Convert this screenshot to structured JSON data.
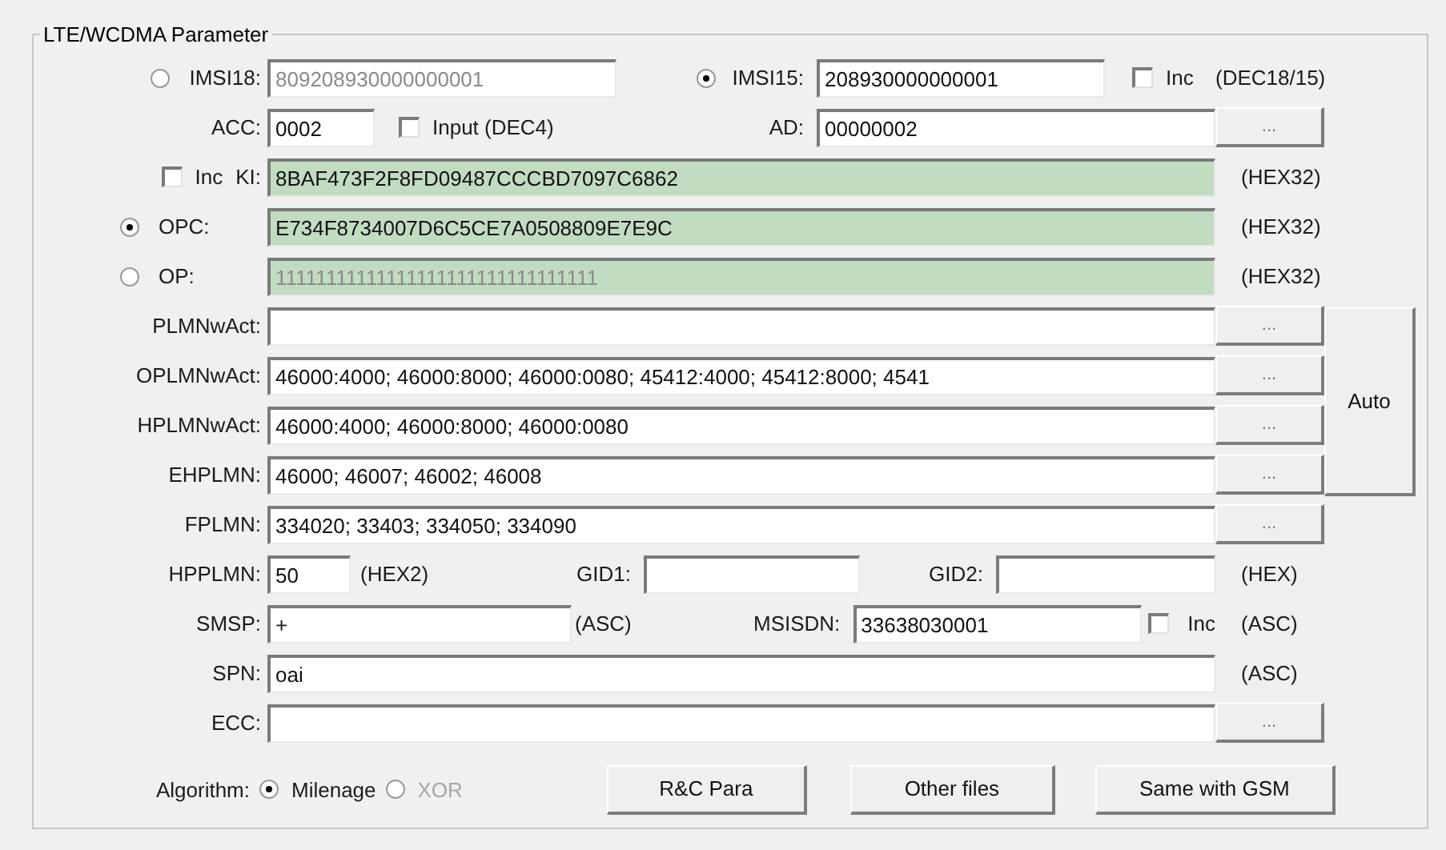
{
  "group_title": "LTE/WCDMA Parameter",
  "imsi18": {
    "label": "IMSI18:",
    "value": "809208930000000001",
    "selected": false,
    "disabled": true
  },
  "imsi15": {
    "label": "IMSI15:",
    "value": "208930000000001",
    "selected": true,
    "disabled": false
  },
  "imsi_inc": {
    "label": "Inc",
    "checked": false
  },
  "imsi_format": "(DEC18/15)",
  "acc": {
    "label": "ACC:",
    "value": "0002"
  },
  "acc_input": {
    "label": "Input (DEC4)",
    "checked": false
  },
  "ad": {
    "label": "AD:",
    "value": "00000002",
    "button": "..."
  },
  "ki": {
    "inc_label": "Inc",
    "inc_checked": false,
    "label": "KI:",
    "value": "8BAF473F2F8FD09487CCCBD7097C6862",
    "format": "(HEX32)"
  },
  "opc": {
    "label": "OPC:",
    "selected": true,
    "disabled": false,
    "value": "E734F8734007D6C5CE7A0508809E7E9C",
    "format": "(HEX32)"
  },
  "op": {
    "label": "OP:",
    "selected": false,
    "disabled": true,
    "value": "11111111111111111111111111111111",
    "format": "(HEX32)"
  },
  "plmn_rows": [
    {
      "label": "PLMNwAct:",
      "button": "..."
    },
    {
      "label": "OPLMNwAct:",
      "value": "46000:4000; 46000:8000; 46000:0080; 45412:4000; 45412:8000; 4541",
      "button": "..."
    },
    {
      "label": "HPLMNwAct:",
      "value": "46000:4000; 46000:8000; 46000:0080",
      "button": "..."
    },
    {
      "label": "EHPLMN:",
      "value": "46000; 46007; 46002; 46008",
      "button": "..."
    }
  ],
  "auto_button": "Auto",
  "fplmn": {
    "label": "FPLMN:",
    "value": "334020; 33403; 334050; 334090",
    "button": "..."
  },
  "hpplmn": {
    "label": "HPPLMN:",
    "value": "50",
    "format": "(HEX2)"
  },
  "gid1": {
    "label": "GID1:"
  },
  "gid2": {
    "label": "GID2:"
  },
  "gid_format": "(HEX)",
  "smsp": {
    "label": "SMSP:",
    "value": "+",
    "format": "(ASC)"
  },
  "msisdn": {
    "label": "MSISDN:",
    "value": "33638030001",
    "inc_label": "Inc",
    "inc_checked": false,
    "format": "(ASC)"
  },
  "spn": {
    "label": "SPN:",
    "value": "oai",
    "format": "(ASC)"
  },
  "ecc": {
    "label": "ECC:",
    "button": "..."
  },
  "algorithm": {
    "label": "Algorithm:",
    "options": [
      {
        "label": "Milenage",
        "selected": true,
        "disabled": false
      },
      {
        "label": "XOR",
        "selected": false,
        "disabled": true
      }
    ]
  },
  "buttons": [
    "R&C Para",
    "Other files",
    "Same with GSM"
  ]
}
